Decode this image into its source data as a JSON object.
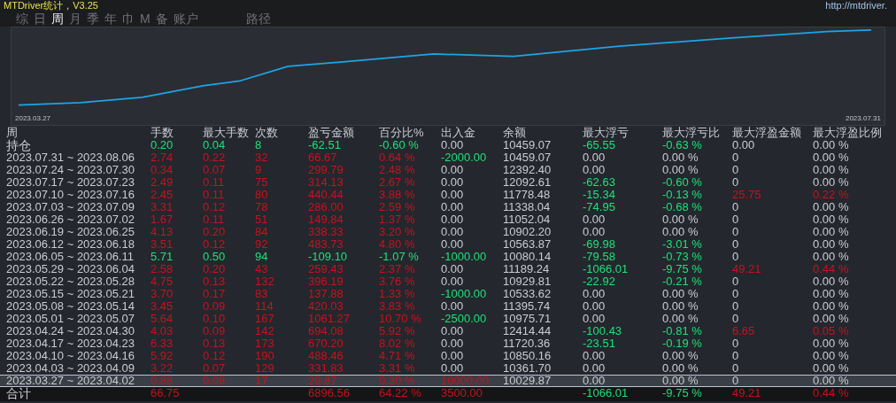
{
  "window": {
    "title": "MTDriver统计，V3.25",
    "url": "http://mtdriver."
  },
  "tabs": [
    {
      "label": "综",
      "selected": false
    },
    {
      "label": "日",
      "selected": false
    },
    {
      "label": "周",
      "selected": true
    },
    {
      "label": "月",
      "selected": false
    },
    {
      "label": "季",
      "selected": false
    },
    {
      "label": "年",
      "selected": false
    },
    {
      "label": "巾",
      "selected": false
    },
    {
      "label": "M",
      "selected": false
    },
    {
      "label": "备",
      "selected": false
    },
    {
      "label": "账户",
      "selected": false
    },
    {
      "label": "路径",
      "selected": false
    }
  ],
  "chart": {
    "start_label": "2023.03.27",
    "end_label": "2023.07.31"
  },
  "table": {
    "columns": [
      "周",
      "手数",
      "最大手数",
      "次数",
      "盈亏金额",
      "百分比%",
      "出入金",
      "余额",
      "最大浮亏",
      "最大浮亏比",
      "最大浮盈金额",
      "最大浮盈比例"
    ],
    "holding": {
      "cells": [
        {
          "text": "持仓",
          "color": "#c9ccd2"
        },
        {
          "text": "0.20",
          "color": "#1fe07a"
        },
        {
          "text": "0.04",
          "color": "#1fe07a"
        },
        {
          "text": "8",
          "color": "#1fe07a"
        },
        {
          "text": "-62.51",
          "color": "#1fe07a"
        },
        {
          "text": "-0.60 %",
          "color": "#1fe07a"
        },
        {
          "text": "0.00",
          "color": "#c9ccd2"
        },
        {
          "text": "10459.07",
          "color": "#c9ccd2"
        },
        {
          "text": "-65.55",
          "color": "#1fe07a"
        },
        {
          "text": "-0.63 %",
          "color": "#1fe07a"
        },
        {
          "text": "0.00",
          "color": "#c9ccd2"
        },
        {
          "text": "0.00 %",
          "color": "#c9ccd2"
        }
      ]
    },
    "rows": [
      {
        "selected": false,
        "cells": [
          {
            "text": "2023.07.31 ~ 2023.08.06",
            "color": "#c9ccd2"
          },
          {
            "text": "2.74",
            "color": "#c8121e"
          },
          {
            "text": "0.22",
            "color": "#c8121e"
          },
          {
            "text": "32",
            "color": "#c8121e"
          },
          {
            "text": "66.67",
            "color": "#c8121e"
          },
          {
            "text": "0.64 %",
            "color": "#c8121e"
          },
          {
            "text": "-2000.00",
            "color": "#1fe07a"
          },
          {
            "text": "10459.07",
            "color": "#c9ccd2"
          },
          {
            "text": "0.00",
            "color": "#c9ccd2"
          },
          {
            "text": "0.00 %",
            "color": "#c9ccd2"
          },
          {
            "text": "0",
            "color": "#c9ccd2"
          },
          {
            "text": "0.00 %",
            "color": "#c9ccd2"
          }
        ]
      },
      {
        "selected": false,
        "cells": [
          {
            "text": "2023.07.24 ~ 2023.07.30",
            "color": "#c9ccd2"
          },
          {
            "text": "0.34",
            "color": "#c8121e"
          },
          {
            "text": "0.07",
            "color": "#c8121e"
          },
          {
            "text": "9",
            "color": "#c8121e"
          },
          {
            "text": "299.79",
            "color": "#c8121e"
          },
          {
            "text": "2.48 %",
            "color": "#c8121e"
          },
          {
            "text": "0.00",
            "color": "#c9ccd2"
          },
          {
            "text": "12392.40",
            "color": "#c9ccd2"
          },
          {
            "text": "0.00",
            "color": "#c9ccd2"
          },
          {
            "text": "0.00 %",
            "color": "#c9ccd2"
          },
          {
            "text": "0",
            "color": "#c9ccd2"
          },
          {
            "text": "0.00 %",
            "color": "#c9ccd2"
          }
        ]
      },
      {
        "selected": false,
        "cells": [
          {
            "text": "2023.07.17 ~ 2023.07.23",
            "color": "#c9ccd2"
          },
          {
            "text": "2.49",
            "color": "#c8121e"
          },
          {
            "text": "0.11",
            "color": "#c8121e"
          },
          {
            "text": "75",
            "color": "#c8121e"
          },
          {
            "text": "314.13",
            "color": "#c8121e"
          },
          {
            "text": "2.67 %",
            "color": "#c8121e"
          },
          {
            "text": "0.00",
            "color": "#c9ccd2"
          },
          {
            "text": "12092.61",
            "color": "#c9ccd2"
          },
          {
            "text": "-62.63",
            "color": "#1fe07a"
          },
          {
            "text": "-0.60 %",
            "color": "#1fe07a"
          },
          {
            "text": "0",
            "color": "#c9ccd2"
          },
          {
            "text": "0.00 %",
            "color": "#c9ccd2"
          }
        ]
      },
      {
        "selected": false,
        "cells": [
          {
            "text": "2023.07.10 ~ 2023.07.16",
            "color": "#c9ccd2"
          },
          {
            "text": "2.45",
            "color": "#c8121e"
          },
          {
            "text": "0.11",
            "color": "#c8121e"
          },
          {
            "text": "80",
            "color": "#c8121e"
          },
          {
            "text": "440.44",
            "color": "#c8121e"
          },
          {
            "text": "3.88 %",
            "color": "#c8121e"
          },
          {
            "text": "0.00",
            "color": "#c9ccd2"
          },
          {
            "text": "11778.48",
            "color": "#c9ccd2"
          },
          {
            "text": "-15.34",
            "color": "#1fe07a"
          },
          {
            "text": "-0.13 %",
            "color": "#1fe07a"
          },
          {
            "text": "25.75",
            "color": "#c8121e"
          },
          {
            "text": "0.22 %",
            "color": "#c8121e"
          }
        ]
      },
      {
        "selected": false,
        "cells": [
          {
            "text": "2023.07.03 ~ 2023.07.09",
            "color": "#c9ccd2"
          },
          {
            "text": "3.31",
            "color": "#c8121e"
          },
          {
            "text": "0.12",
            "color": "#c8121e"
          },
          {
            "text": "78",
            "color": "#c8121e"
          },
          {
            "text": "286.00",
            "color": "#c8121e"
          },
          {
            "text": "2.59 %",
            "color": "#c8121e"
          },
          {
            "text": "0.00",
            "color": "#c9ccd2"
          },
          {
            "text": "11338.04",
            "color": "#c9ccd2"
          },
          {
            "text": "-74.95",
            "color": "#1fe07a"
          },
          {
            "text": "-0.68 %",
            "color": "#1fe07a"
          },
          {
            "text": "0",
            "color": "#c9ccd2"
          },
          {
            "text": "0.00 %",
            "color": "#c9ccd2"
          }
        ]
      },
      {
        "selected": false,
        "cells": [
          {
            "text": "2023.06.26 ~ 2023.07.02",
            "color": "#c9ccd2"
          },
          {
            "text": "1.67",
            "color": "#c8121e"
          },
          {
            "text": "0.11",
            "color": "#c8121e"
          },
          {
            "text": "51",
            "color": "#c8121e"
          },
          {
            "text": "149.84",
            "color": "#c8121e"
          },
          {
            "text": "1.37 %",
            "color": "#c8121e"
          },
          {
            "text": "0.00",
            "color": "#c9ccd2"
          },
          {
            "text": "11052.04",
            "color": "#c9ccd2"
          },
          {
            "text": "0.00",
            "color": "#c9ccd2"
          },
          {
            "text": "0.00 %",
            "color": "#c9ccd2"
          },
          {
            "text": "0",
            "color": "#c9ccd2"
          },
          {
            "text": "0.00 %",
            "color": "#c9ccd2"
          }
        ]
      },
      {
        "selected": false,
        "cells": [
          {
            "text": "2023.06.19 ~ 2023.06.25",
            "color": "#c9ccd2"
          },
          {
            "text": "4.13",
            "color": "#c8121e"
          },
          {
            "text": "0.20",
            "color": "#c8121e"
          },
          {
            "text": "84",
            "color": "#c8121e"
          },
          {
            "text": "338.33",
            "color": "#c8121e"
          },
          {
            "text": "3.20 %",
            "color": "#c8121e"
          },
          {
            "text": "0.00",
            "color": "#c9ccd2"
          },
          {
            "text": "10902.20",
            "color": "#c9ccd2"
          },
          {
            "text": "0.00",
            "color": "#c9ccd2"
          },
          {
            "text": "0.00 %",
            "color": "#c9ccd2"
          },
          {
            "text": "0",
            "color": "#c9ccd2"
          },
          {
            "text": "0.00 %",
            "color": "#c9ccd2"
          }
        ]
      },
      {
        "selected": false,
        "cells": [
          {
            "text": "2023.06.12 ~ 2023.06.18",
            "color": "#c9ccd2"
          },
          {
            "text": "3.51",
            "color": "#c8121e"
          },
          {
            "text": "0.12",
            "color": "#c8121e"
          },
          {
            "text": "92",
            "color": "#c8121e"
          },
          {
            "text": "483.73",
            "color": "#c8121e"
          },
          {
            "text": "4.80 %",
            "color": "#c8121e"
          },
          {
            "text": "0.00",
            "color": "#c9ccd2"
          },
          {
            "text": "10563.87",
            "color": "#c9ccd2"
          },
          {
            "text": "-69.98",
            "color": "#1fe07a"
          },
          {
            "text": "-3.01 %",
            "color": "#1fe07a"
          },
          {
            "text": "0",
            "color": "#c9ccd2"
          },
          {
            "text": "0.00 %",
            "color": "#c9ccd2"
          }
        ]
      },
      {
        "selected": false,
        "cells": [
          {
            "text": "2023.06.05 ~ 2023.06.11",
            "color": "#c9ccd2"
          },
          {
            "text": "5.71",
            "color": "#1fe07a"
          },
          {
            "text": "0.50",
            "color": "#1fe07a"
          },
          {
            "text": "94",
            "color": "#1fe07a"
          },
          {
            "text": "-109.10",
            "color": "#1fe07a"
          },
          {
            "text": "-1.07 %",
            "color": "#1fe07a"
          },
          {
            "text": "-1000.00",
            "color": "#1fe07a"
          },
          {
            "text": "10080.14",
            "color": "#c9ccd2"
          },
          {
            "text": "-79.58",
            "color": "#1fe07a"
          },
          {
            "text": "-0.73 %",
            "color": "#1fe07a"
          },
          {
            "text": "0",
            "color": "#c9ccd2"
          },
          {
            "text": "0.00 %",
            "color": "#c9ccd2"
          }
        ]
      },
      {
        "selected": false,
        "cells": [
          {
            "text": "2023.05.29 ~ 2023.06.04",
            "color": "#c9ccd2"
          },
          {
            "text": "2.58",
            "color": "#c8121e"
          },
          {
            "text": "0.20",
            "color": "#c8121e"
          },
          {
            "text": "43",
            "color": "#c8121e"
          },
          {
            "text": "259.43",
            "color": "#c8121e"
          },
          {
            "text": "2.37 %",
            "color": "#c8121e"
          },
          {
            "text": "0.00",
            "color": "#c9ccd2"
          },
          {
            "text": "11189.24",
            "color": "#c9ccd2"
          },
          {
            "text": "-1066.01",
            "color": "#1fe07a"
          },
          {
            "text": "-9.75 %",
            "color": "#1fe07a"
          },
          {
            "text": "49.21",
            "color": "#c8121e"
          },
          {
            "text": "0.44 %",
            "color": "#c8121e"
          }
        ]
      },
      {
        "selected": false,
        "cells": [
          {
            "text": "2023.05.22 ~ 2023.05.28",
            "color": "#c9ccd2"
          },
          {
            "text": "4.75",
            "color": "#c8121e"
          },
          {
            "text": "0.13",
            "color": "#c8121e"
          },
          {
            "text": "132",
            "color": "#c8121e"
          },
          {
            "text": "396.19",
            "color": "#c8121e"
          },
          {
            "text": "3.76 %",
            "color": "#c8121e"
          },
          {
            "text": "0.00",
            "color": "#c9ccd2"
          },
          {
            "text": "10929.81",
            "color": "#c9ccd2"
          },
          {
            "text": "-22.92",
            "color": "#1fe07a"
          },
          {
            "text": "-0.21 %",
            "color": "#1fe07a"
          },
          {
            "text": "0",
            "color": "#c9ccd2"
          },
          {
            "text": "0.00 %",
            "color": "#c9ccd2"
          }
        ]
      },
      {
        "selected": false,
        "cells": [
          {
            "text": "2023.05.15 ~ 2023.05.21",
            "color": "#c9ccd2"
          },
          {
            "text": "3.70",
            "color": "#c8121e"
          },
          {
            "text": "0.17",
            "color": "#c8121e"
          },
          {
            "text": "83",
            "color": "#c8121e"
          },
          {
            "text": "137.88",
            "color": "#c8121e"
          },
          {
            "text": "1.33 %",
            "color": "#c8121e"
          },
          {
            "text": "-1000.00",
            "color": "#1fe07a"
          },
          {
            "text": "10533.62",
            "color": "#c9ccd2"
          },
          {
            "text": "0.00",
            "color": "#c9ccd2"
          },
          {
            "text": "0.00 %",
            "color": "#c9ccd2"
          },
          {
            "text": "0",
            "color": "#c9ccd2"
          },
          {
            "text": "0.00 %",
            "color": "#c9ccd2"
          }
        ]
      },
      {
        "selected": false,
        "cells": [
          {
            "text": "2023.05.08 ~ 2023.05.14",
            "color": "#c9ccd2"
          },
          {
            "text": "3.45",
            "color": "#c8121e"
          },
          {
            "text": "0.09",
            "color": "#c8121e"
          },
          {
            "text": "114",
            "color": "#c8121e"
          },
          {
            "text": "420.03",
            "color": "#c8121e"
          },
          {
            "text": "3.83 %",
            "color": "#c8121e"
          },
          {
            "text": "0.00",
            "color": "#c9ccd2"
          },
          {
            "text": "11395.74",
            "color": "#c9ccd2"
          },
          {
            "text": "0.00",
            "color": "#c9ccd2"
          },
          {
            "text": "0.00 %",
            "color": "#c9ccd2"
          },
          {
            "text": "0",
            "color": "#c9ccd2"
          },
          {
            "text": "0.00 %",
            "color": "#c9ccd2"
          }
        ]
      },
      {
        "selected": false,
        "cells": [
          {
            "text": "2023.05.01 ~ 2023.05.07",
            "color": "#c9ccd2"
          },
          {
            "text": "5.64",
            "color": "#c8121e"
          },
          {
            "text": "0.10",
            "color": "#c8121e"
          },
          {
            "text": "167",
            "color": "#c8121e"
          },
          {
            "text": "1061.27",
            "color": "#c8121e"
          },
          {
            "text": "10.70 %",
            "color": "#c8121e"
          },
          {
            "text": "-2500.00",
            "color": "#1fe07a"
          },
          {
            "text": "10975.71",
            "color": "#c9ccd2"
          },
          {
            "text": "0.00",
            "color": "#c9ccd2"
          },
          {
            "text": "0.00 %",
            "color": "#c9ccd2"
          },
          {
            "text": "0",
            "color": "#c9ccd2"
          },
          {
            "text": "0.00 %",
            "color": "#c9ccd2"
          }
        ]
      },
      {
        "selected": false,
        "cells": [
          {
            "text": "2023.04.24 ~ 2023.04.30",
            "color": "#c9ccd2"
          },
          {
            "text": "4.03",
            "color": "#c8121e"
          },
          {
            "text": "0.09",
            "color": "#c8121e"
          },
          {
            "text": "142",
            "color": "#c8121e"
          },
          {
            "text": "694.08",
            "color": "#c8121e"
          },
          {
            "text": "5.92 %",
            "color": "#c8121e"
          },
          {
            "text": "0.00",
            "color": "#c9ccd2"
          },
          {
            "text": "12414.44",
            "color": "#c9ccd2"
          },
          {
            "text": "-100.43",
            "color": "#1fe07a"
          },
          {
            "text": "-0.81 %",
            "color": "#1fe07a"
          },
          {
            "text": "6.65",
            "color": "#c8121e"
          },
          {
            "text": "0.05 %",
            "color": "#c8121e"
          }
        ]
      },
      {
        "selected": false,
        "cells": [
          {
            "text": "2023.04.17 ~ 2023.04.23",
            "color": "#c9ccd2"
          },
          {
            "text": "6.33",
            "color": "#c8121e"
          },
          {
            "text": "0.13",
            "color": "#c8121e"
          },
          {
            "text": "173",
            "color": "#c8121e"
          },
          {
            "text": "670.20",
            "color": "#c8121e"
          },
          {
            "text": "8.02 %",
            "color": "#c8121e"
          },
          {
            "text": "0.00",
            "color": "#c9ccd2"
          },
          {
            "text": "11720.36",
            "color": "#c9ccd2"
          },
          {
            "text": "-23.51",
            "color": "#1fe07a"
          },
          {
            "text": "-0.19 %",
            "color": "#1fe07a"
          },
          {
            "text": "0",
            "color": "#c9ccd2"
          },
          {
            "text": "0.00 %",
            "color": "#c9ccd2"
          }
        ]
      },
      {
        "selected": false,
        "cells": [
          {
            "text": "2023.04.10 ~ 2023.04.16",
            "color": "#c9ccd2"
          },
          {
            "text": "5.92",
            "color": "#c8121e"
          },
          {
            "text": "0.12",
            "color": "#c8121e"
          },
          {
            "text": "190",
            "color": "#c8121e"
          },
          {
            "text": "488.46",
            "color": "#c8121e"
          },
          {
            "text": "4.71 %",
            "color": "#c8121e"
          },
          {
            "text": "0.00",
            "color": "#c9ccd2"
          },
          {
            "text": "10850.16",
            "color": "#c9ccd2"
          },
          {
            "text": "0.00",
            "color": "#c9ccd2"
          },
          {
            "text": "0.00 %",
            "color": "#c9ccd2"
          },
          {
            "text": "0",
            "color": "#c9ccd2"
          },
          {
            "text": "0.00 %",
            "color": "#c9ccd2"
          }
        ]
      },
      {
        "selected": false,
        "cells": [
          {
            "text": "2023.04.03 ~ 2023.04.09",
            "color": "#c9ccd2"
          },
          {
            "text": "3.22",
            "color": "#c8121e"
          },
          {
            "text": "0.07",
            "color": "#c8121e"
          },
          {
            "text": "129",
            "color": "#c8121e"
          },
          {
            "text": "331.83",
            "color": "#c8121e"
          },
          {
            "text": "3.31 %",
            "color": "#c8121e"
          },
          {
            "text": "0.00",
            "color": "#c9ccd2"
          },
          {
            "text": "10361.70",
            "color": "#c9ccd2"
          },
          {
            "text": "0.00",
            "color": "#c9ccd2"
          },
          {
            "text": "0.00 %",
            "color": "#c9ccd2"
          },
          {
            "text": "0",
            "color": "#c9ccd2"
          },
          {
            "text": "0.00 %",
            "color": "#c9ccd2"
          }
        ]
      },
      {
        "selected": true,
        "cells": [
          {
            "text": "2023.03.27 ~ 2023.04.02",
            "color": "#c9ccd2"
          },
          {
            "text": "0.88",
            "color": "#c8121e"
          },
          {
            "text": "0.08",
            "color": "#c8121e"
          },
          {
            "text": "17",
            "color": "#c8121e"
          },
          {
            "text": "29.87",
            "color": "#c8121e"
          },
          {
            "text": "0.30 %",
            "color": "#c8121e"
          },
          {
            "text": "10000.00",
            "color": "#c8121e"
          },
          {
            "text": "10029.87",
            "color": "#c9ccd2"
          },
          {
            "text": "0.00",
            "color": "#c9ccd2"
          },
          {
            "text": "0.00 %",
            "color": "#c9ccd2"
          },
          {
            "text": "0",
            "color": "#c9ccd2"
          },
          {
            "text": "0.00 %",
            "color": "#c9ccd2"
          }
        ]
      }
    ],
    "total": {
      "cells": [
        {
          "text": "合计",
          "color": "#c9ccd2"
        },
        {
          "text": "66.75",
          "color": "#c8121e"
        },
        {
          "text": ""
        },
        {
          "text": ""
        },
        {
          "text": "6896.56",
          "color": "#c8121e"
        },
        {
          "text": "64.22 %",
          "color": "#c8121e"
        },
        {
          "text": "3500.00",
          "color": "#c8121e"
        },
        {
          "text": ""
        },
        {
          "text": "-1066.01",
          "color": "#1fe07a"
        },
        {
          "text": "-9.75 %",
          "color": "#1fe07a"
        },
        {
          "text": "49.21",
          "color": "#c8121e"
        },
        {
          "text": "0.44 %",
          "color": "#c8121e"
        }
      ]
    }
  }
}
